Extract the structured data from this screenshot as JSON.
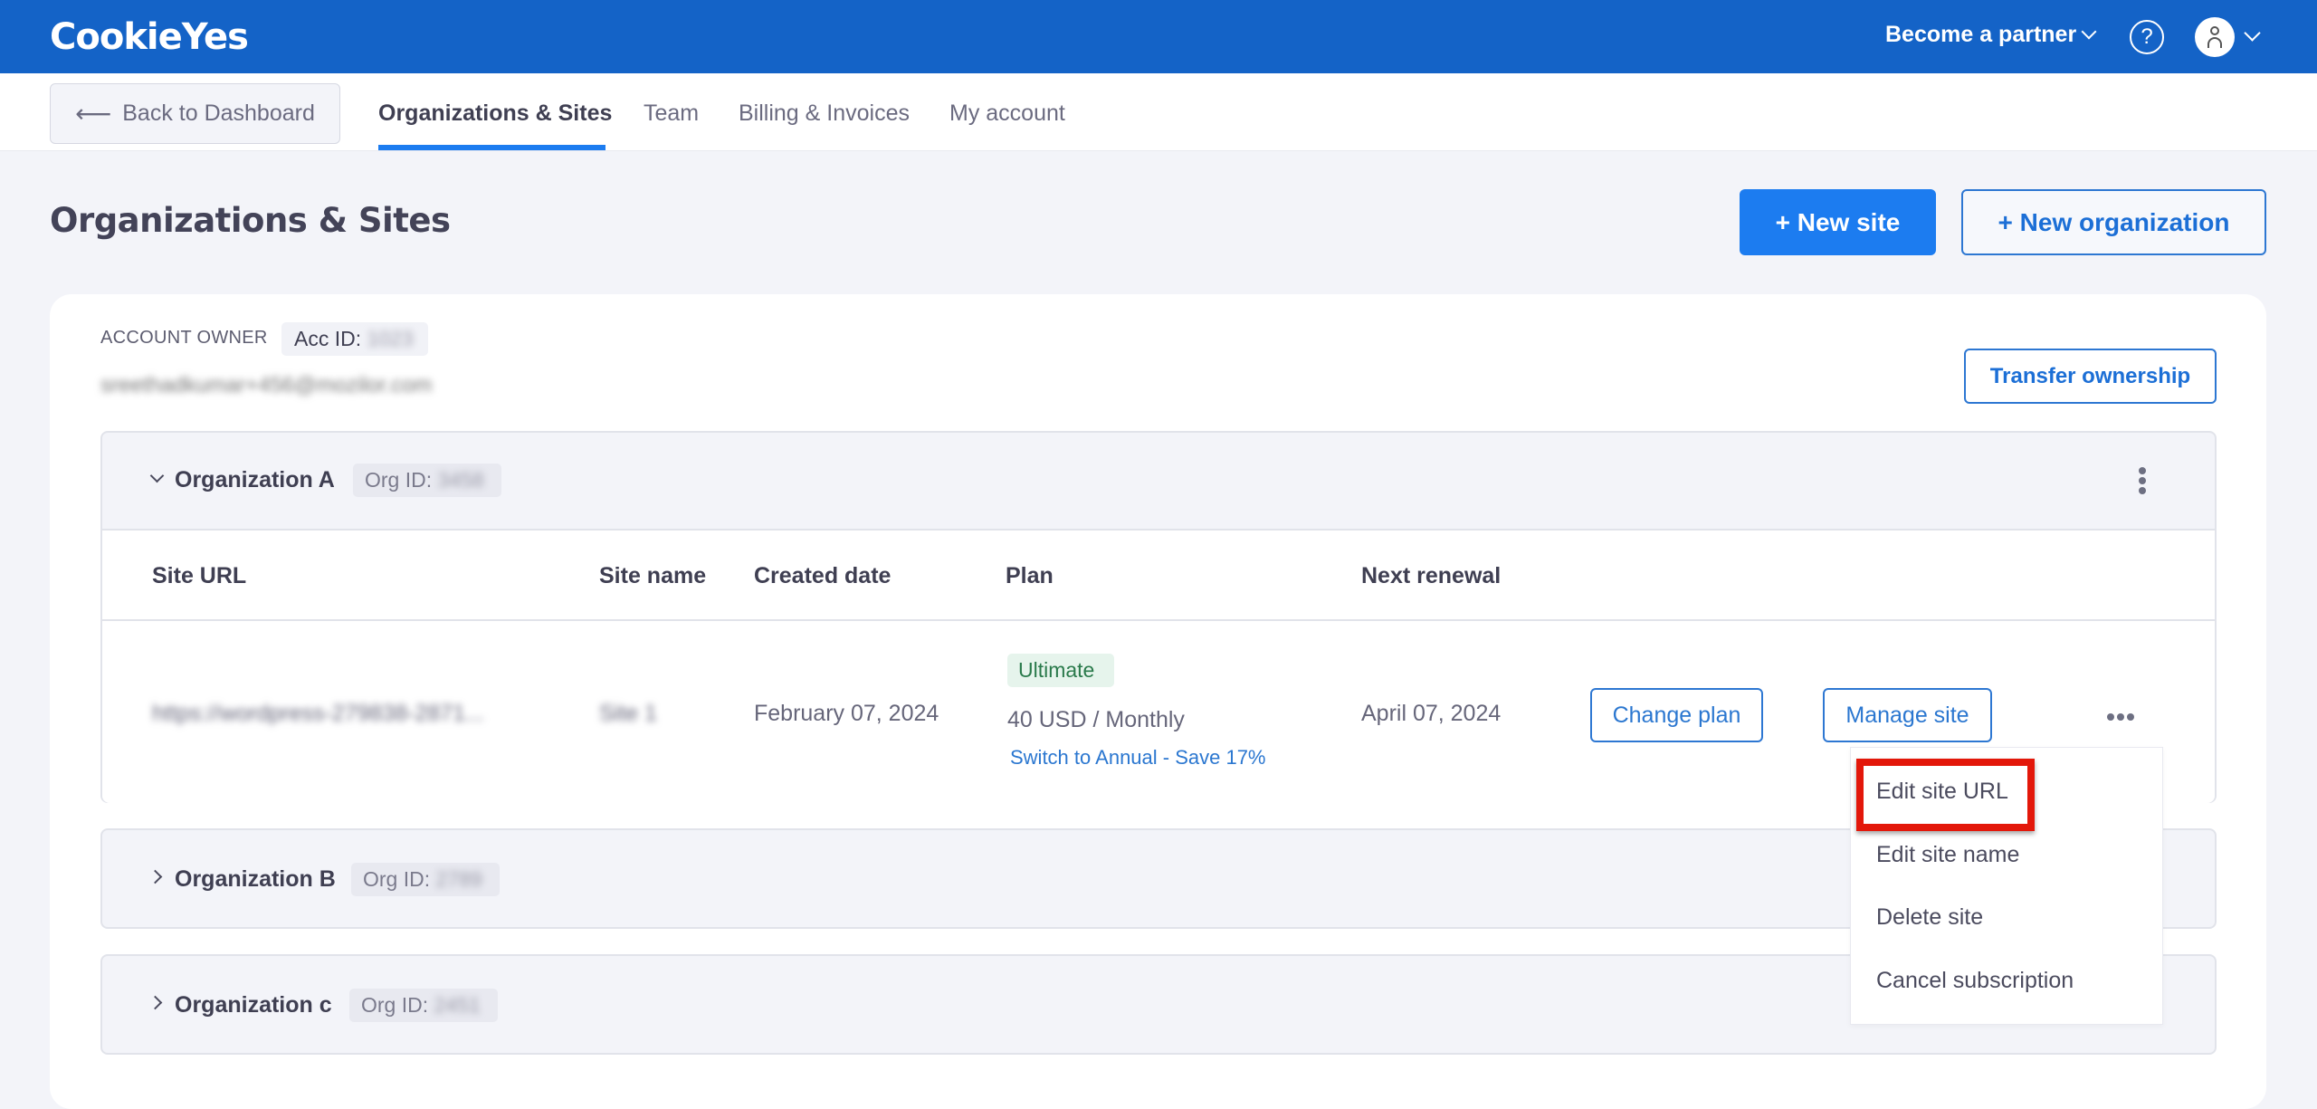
{
  "topbar": {
    "logo": "CookieYes",
    "partner_label": "Become a partner",
    "help_icon": "?",
    "brand_color": "#1463c7"
  },
  "subnav": {
    "back_label": "Back to Dashboard",
    "tabs": [
      {
        "label": "Organizations & Sites",
        "active": true
      },
      {
        "label": "Team",
        "active": false
      },
      {
        "label": "Billing & Invoices",
        "active": false
      },
      {
        "label": "My account",
        "active": false
      }
    ]
  },
  "page": {
    "title": "Organizations & Sites",
    "new_site_label": "+ New site",
    "new_org_label": "+ New organization",
    "accent_color": "#1c7cf0"
  },
  "account": {
    "owner_label": "ACCOUNT OWNER",
    "acc_id_label": "Acc ID:",
    "acc_id_value": "1023",
    "email": "sreethadkumar+456@mozilor.com",
    "transfer_label": "Transfer ownership"
  },
  "organizations": [
    {
      "name": "Organization A",
      "org_id_label": "Org ID:",
      "org_id_value": "3458",
      "expanded": true,
      "columns": [
        "Site URL",
        "Site name",
        "Created date",
        "Plan",
        "Next renewal"
      ],
      "sites": [
        {
          "url": "https://wordpress-279838-2871...",
          "name": "Site 1",
          "created": "February 07, 2024",
          "plan_badge": "Ultimate",
          "price": "40 USD / Monthly",
          "switch_link": "Switch to Annual - Save 17%",
          "renewal": "April 07, 2024",
          "change_plan_label": "Change plan",
          "manage_label": "Manage site"
        }
      ]
    },
    {
      "name": "Organization B",
      "org_id_label": "Org ID:",
      "org_id_value": "2789",
      "expanded": false
    },
    {
      "name": "Organization c",
      "org_id_label": "Org ID:",
      "org_id_value": "2451",
      "expanded": false
    }
  ],
  "site_menu": {
    "items": [
      "Edit site URL",
      "Edit site name",
      "Delete site",
      "Cancel subscription"
    ],
    "highlighted_index": 0,
    "highlight_color": "#e3170a"
  }
}
